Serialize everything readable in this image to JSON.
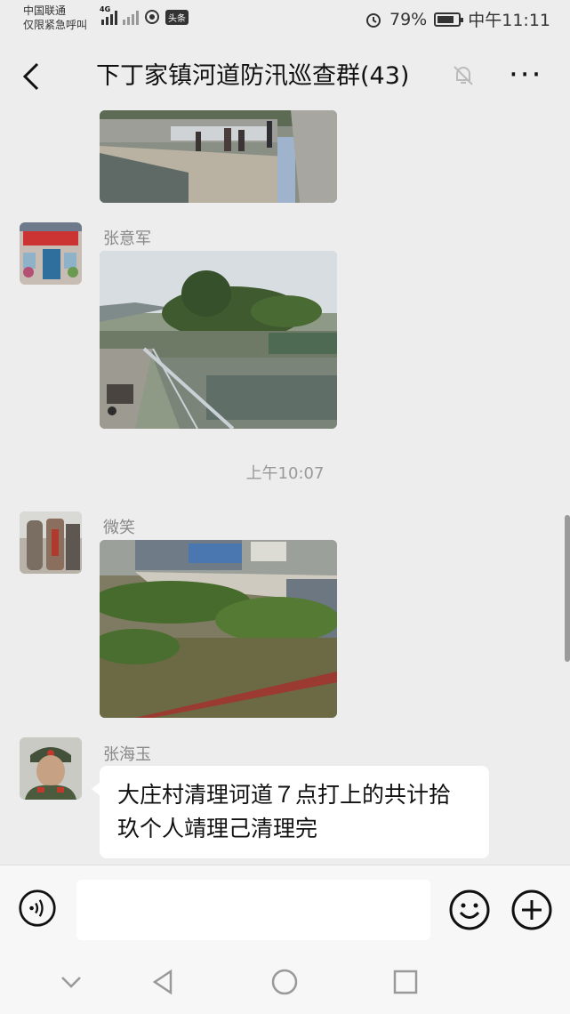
{
  "status": {
    "carrier": "中国联通",
    "emergency": "仅限紧急呼叫",
    "network": "4G",
    "headline_tag": "头条",
    "battery": "79%",
    "time": "中午11:11"
  },
  "header": {
    "title": "下丁家镇河道防汛巡查群(43)",
    "more": "···"
  },
  "messages": [
    {
      "type": "image",
      "sender": ""
    },
    {
      "type": "image",
      "sender": "张意军"
    },
    {
      "type": "time",
      "text": "上午10:07"
    },
    {
      "type": "image",
      "sender": "微笑"
    },
    {
      "type": "text",
      "sender": "张海玉",
      "text": "大庄村清理诃道７点打上的共计拾玖个人靖理己清理完"
    }
  ],
  "input": {
    "placeholder": ""
  },
  "icons": [
    "back-icon",
    "mute-bell-icon",
    "more-icon",
    "voice-icon",
    "emoji-icon",
    "add-icon",
    "nav-back-icon",
    "nav-home-icon",
    "nav-recents-icon",
    "nav-collapse-icon"
  ],
  "colors": {
    "background": "#ededed",
    "bubble": "#ffffff",
    "bar": "#f7f7f7"
  }
}
